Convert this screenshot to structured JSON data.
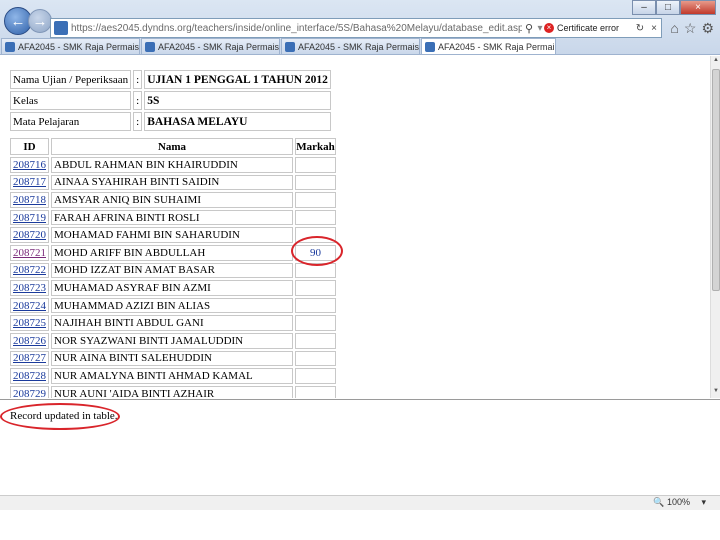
{
  "browser": {
    "url": "https://aes2045.dyndns.org/teachers/inside/online_interface/5S/Bahasa%20Melayu/database_edit.asp",
    "cert_error": "Certificate error",
    "tabs": [
      {
        "label": "AFA2045 - SMK Raja Permaisur..."
      },
      {
        "label": "AFA2045 - SMK Raja Permaisur..."
      },
      {
        "label": "AFA2045 - SMK Raja Permaisur..."
      },
      {
        "label": "AFA2045 - SMK Raja Permai..."
      }
    ],
    "zoom": "100%"
  },
  "info": {
    "exam_label": "Nama Ujian / Peperiksaan",
    "exam_value": "UJIAN 1 PENGGAL 1 TAHUN 2012",
    "class_label": "Kelas",
    "class_value": "5S",
    "subject_label": "Mata Pelajaran",
    "subject_value": "BAHASA MELAYU",
    "colon": ":"
  },
  "table": {
    "headers": {
      "id": "ID",
      "nama": "Nama",
      "markah": "Markah"
    },
    "rows": [
      {
        "id": "208716",
        "nama": "ABDUL RAHMAN BIN KHAIRUDDIN",
        "markah": ""
      },
      {
        "id": "208717",
        "nama": "AINAA SYAHIRAH BINTI SAIDIN",
        "markah": ""
      },
      {
        "id": "208718",
        "nama": "AMSYAR ANIQ BIN SUHAIMI",
        "markah": ""
      },
      {
        "id": "208719",
        "nama": "FARAH AFRINA BINTI ROSLI",
        "markah": ""
      },
      {
        "id": "208720",
        "nama": "MOHAMAD FAHMI BIN SAHARUDIN",
        "markah": ""
      },
      {
        "id": "208721",
        "nama": "MOHD ARIFF BIN ABDULLAH",
        "markah": "90"
      },
      {
        "id": "208722",
        "nama": "MOHD IZZAT BIN AMAT BASAR",
        "markah": ""
      },
      {
        "id": "208723",
        "nama": "MUHAMAD ASYRAF BIN AZMI",
        "markah": ""
      },
      {
        "id": "208724",
        "nama": "MUHAMMAD AZIZI BIN ALIAS",
        "markah": ""
      },
      {
        "id": "208725",
        "nama": "NAJIHAH BINTI ABDUL GANI",
        "markah": ""
      },
      {
        "id": "208726",
        "nama": "NOR SYAZWANI BINTI JAMALUDDIN",
        "markah": ""
      },
      {
        "id": "208727",
        "nama": "NUR AINA BINTI SALEHUDDIN",
        "markah": ""
      },
      {
        "id": "208728",
        "nama": "NUR AMALYNA BINTI AHMAD KAMAL",
        "markah": ""
      },
      {
        "id": "208729",
        "nama": "NUR AUNI 'AIDA BINTI AZHAIR",
        "markah": ""
      }
    ]
  },
  "status": {
    "message": "Record updated in table."
  },
  "colors": {
    "annotation": "#d9252b",
    "link": "#1a3a9c",
    "visited_link": "#7a2a7a"
  }
}
